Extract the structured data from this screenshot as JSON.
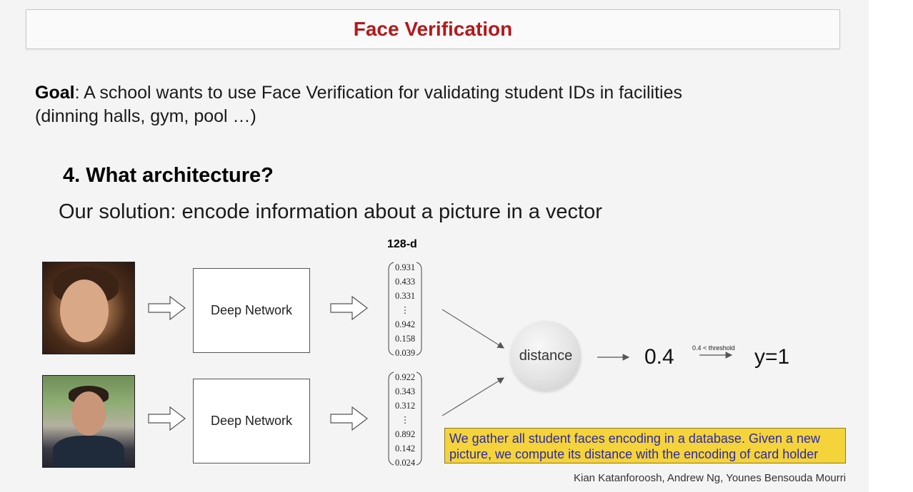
{
  "title": "Face Verification",
  "goal": {
    "label": "Goal",
    "text": ": A school wants to use Face Verification for validating student IDs in facilities",
    "text_line2": "(dinning halls, gym, pool …)"
  },
  "heading": "4.  What architecture?",
  "solution": "Our solution: encode information about a picture in a vector",
  "diagram": {
    "dimension_label": "128-d",
    "network_label": "Deep Network",
    "vector_top": [
      "0.931",
      "0.433",
      "0.331",
      "⋮",
      "0.942",
      "0.158",
      "0.039"
    ],
    "vector_bottom": [
      "0.922",
      "0.343",
      "0.312",
      "⋮",
      "0.892",
      "0.142",
      "0.024"
    ],
    "distance_label": "distance",
    "distance_value": "0.4",
    "threshold_label": "0.4 < threshold",
    "result": "y=1"
  },
  "note": "We gather all student faces encoding in a database. Given a new picture, we compute its distance with the encoding of card holder",
  "credit": "Kian Katanforoosh, Andrew Ng, Younes Bensouda Mourri",
  "colors": {
    "title": "#b3191c",
    "note_background": "#f5d33a",
    "note_text": "#2a2aa8"
  }
}
